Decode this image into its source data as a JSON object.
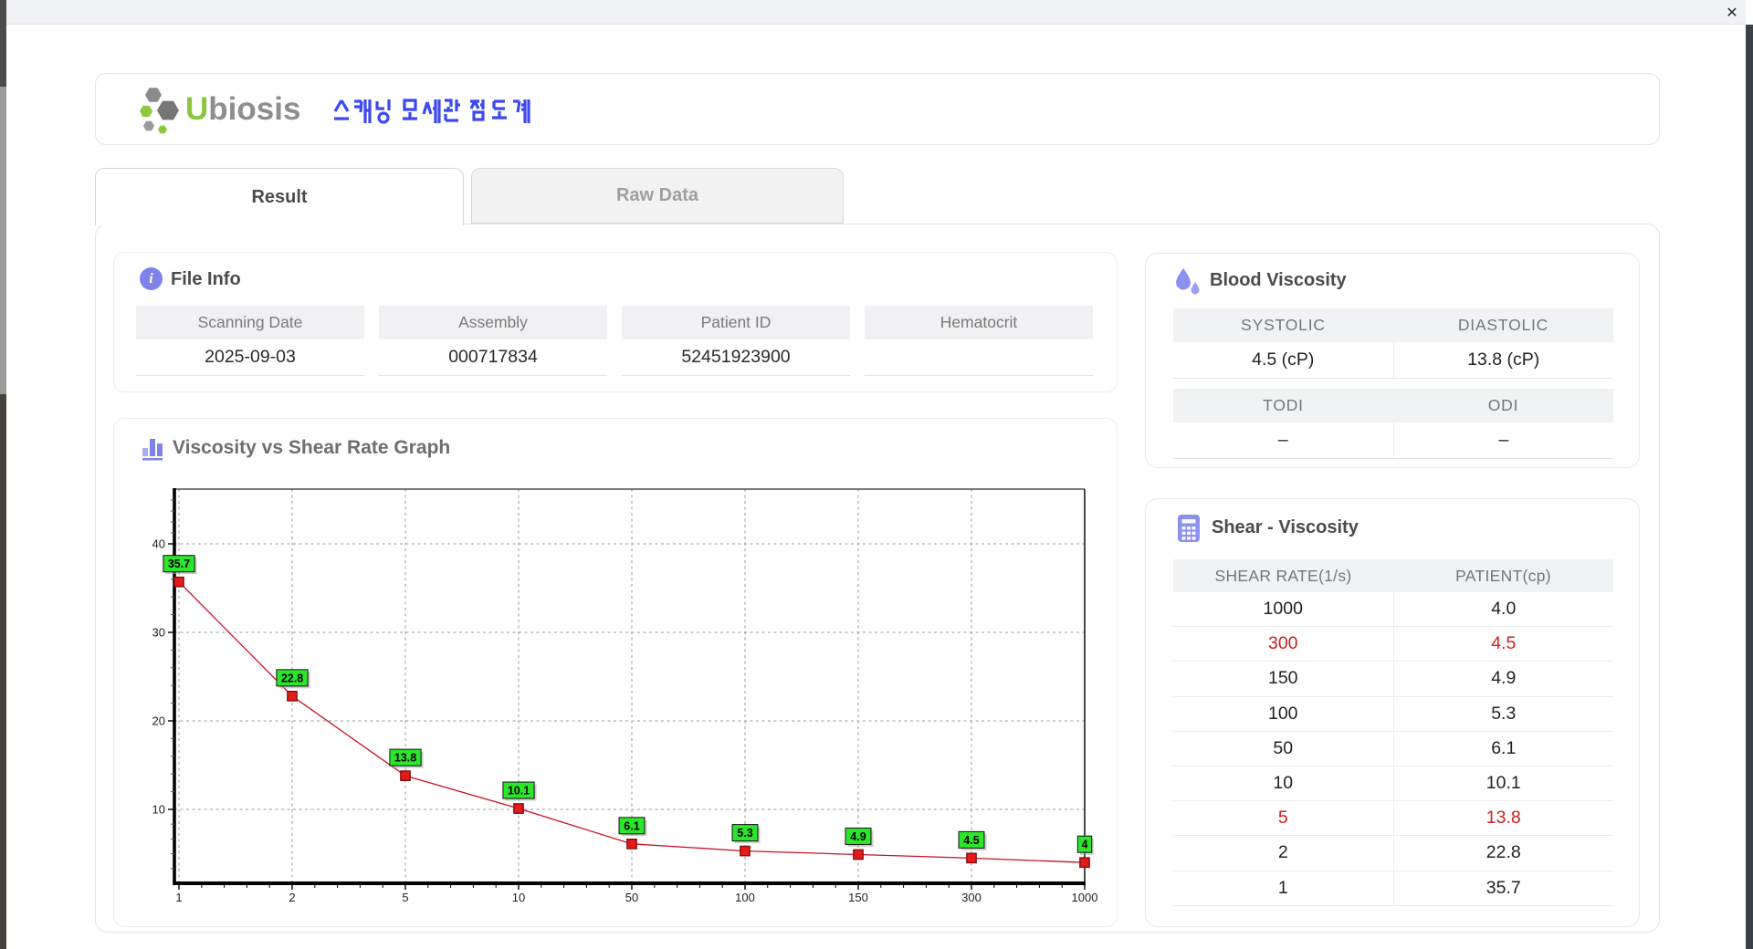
{
  "window": {
    "close_label": "✕"
  },
  "header": {
    "brand_u": "U",
    "brand_rest": "biosis",
    "app_title_korean": "스캐닝 모세관 점도계"
  },
  "tabs": [
    {
      "label": "Result",
      "active": true
    },
    {
      "label": "Raw Data",
      "active": false
    }
  ],
  "file_info": {
    "title": "File Info",
    "fields": [
      {
        "label": "Scanning Date",
        "value": "2025-09-03"
      },
      {
        "label": "Assembly",
        "value": "000717834"
      },
      {
        "label": "Patient ID",
        "value": "52451923900"
      },
      {
        "label": "Hematocrit",
        "value": ""
      }
    ]
  },
  "blood_viscosity": {
    "title": "Blood Viscosity",
    "groups": [
      {
        "labels": [
          "SYSTOLIC",
          "DIASTOLIC"
        ],
        "values": [
          "4.5 (cP)",
          "13.8 (cP)"
        ]
      },
      {
        "labels": [
          "TODI",
          "ODI"
        ],
        "values": [
          "–",
          "–"
        ]
      }
    ]
  },
  "shear_viscosity": {
    "title": "Shear - Viscosity",
    "columns": [
      "SHEAR RATE(1/s)",
      "PATIENT(cp)"
    ],
    "rows": [
      {
        "shear": "1000",
        "patient": "4.0",
        "highlight": false
      },
      {
        "shear": "300",
        "patient": "4.5",
        "highlight": true
      },
      {
        "shear": "150",
        "patient": "4.9",
        "highlight": false
      },
      {
        "shear": "100",
        "patient": "5.3",
        "highlight": false
      },
      {
        "shear": "50",
        "patient": "6.1",
        "highlight": false
      },
      {
        "shear": "10",
        "patient": "10.1",
        "highlight": false
      },
      {
        "shear": "5",
        "patient": "13.8",
        "highlight": true
      },
      {
        "shear": "2",
        "patient": "22.8",
        "highlight": false
      },
      {
        "shear": "1",
        "patient": "35.7",
        "highlight": false
      }
    ]
  },
  "chart_data": {
    "type": "line",
    "title": "Viscosity vs Shear Rate Graph",
    "x": [
      1,
      2,
      5,
      10,
      50,
      100,
      150,
      300,
      1000
    ],
    "x_scale": "categorical-equal-spacing",
    "x_ticks": [
      "1",
      "2",
      "5",
      "10",
      "50",
      "100",
      "150",
      "300",
      "1000"
    ],
    "series": [
      {
        "name": "PATIENT",
        "values": [
          35.7,
          22.8,
          13.8,
          10.1,
          6.1,
          5.3,
          4.9,
          4.5,
          4.0
        ]
      }
    ],
    "point_labels": [
      "35.7",
      "22.8",
      "13.8",
      "10.1",
      "6.1",
      "5.3",
      "4.9",
      "4.5",
      "4"
    ],
    "y_ticks": [
      10,
      20,
      30,
      40
    ],
    "ylim": [
      0,
      45.2
    ],
    "grid": "dashed",
    "xlabel": "",
    "ylabel": "",
    "line_color": "#c41226",
    "marker_color": "#e51a1a",
    "label_bg": "#2ce62c"
  },
  "colors": {
    "accent_periwinkle": "#7d83e9",
    "title_blue": "#3c49ee",
    "brand_green": "#8cc63e",
    "highlight_red": "#cb2020",
    "header_gray_bg": "#f1f2f4"
  }
}
